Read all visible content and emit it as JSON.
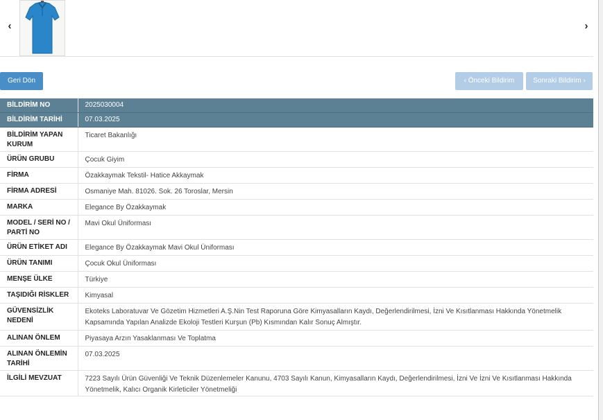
{
  "carousel": {
    "prev_symbol": "‹",
    "next_symbol": "›",
    "image_icon": "shirt-icon",
    "shirt_color": "#2a86c8"
  },
  "buttons": {
    "back": "Geri Dön",
    "prev": "‹ Önceki Bildirim",
    "next": "Sonraki Bildirim ›"
  },
  "colors": {
    "header_row": "#5c8094",
    "primary_button": "#4a8ec8",
    "disabled_button": "#b3cde6"
  },
  "details": [
    {
      "label": "BİLDİRİM NO",
      "value": "2025030004"
    },
    {
      "label": "BİLDİRİM TARİHİ",
      "value": "07.03.2025"
    },
    {
      "label": "BİLDİRİM YAPAN KURUM",
      "value": "Ticaret Bakanlığı"
    },
    {
      "label": "ÜRÜN GRUBU",
      "value": "Çocuk Giyim"
    },
    {
      "label": "FİRMA",
      "value": "Özakkaymak Tekstil- Hatice Akkaymak"
    },
    {
      "label": "FİRMA ADRESİ",
      "value": "Osmaniye Mah. 81026. Sok. 26 Toroslar, Mersin"
    },
    {
      "label": "MARKA",
      "value": "Elegance By Özakkaymak"
    },
    {
      "label": "MODEL / SERİ NO / PARTİ NO",
      "value": "Mavi Okul Üniforması"
    },
    {
      "label": "ÜRÜN ETİKET ADI",
      "value": "Elegance By Özakkaymak Mavi Okul Üniforması"
    },
    {
      "label": "ÜRÜN TANIMI",
      "value": "Çocuk Okul Üniforması"
    },
    {
      "label": "MENŞE ÜLKE",
      "value": "Türkiye"
    },
    {
      "label": "TAŞIDIĞI RİSKLER",
      "value": "Kimyasal"
    },
    {
      "label": "GÜVENSİZLİK NEDENİ",
      "value": "Ekoteks Laboratuvar Ve Gözetim Hizmetleri A.Ş.Nin Test Raporuna Göre Kimyasalların Kaydı, Değerlendirilmesi, İzni Ve Kısıtlanması Hakkında Yönetmelik Kapsamında Yapılan Analizde Ekoloji Testleri Kurşun (Pb) Kısmından Kalır Sonuç Almıştır."
    },
    {
      "label": "ALINAN ÖNLEM",
      "value": "Piyasaya Arzın Yasaklanması Ve Toplatma"
    },
    {
      "label": "ALINAN ÖNLEMİN TARİHİ",
      "value": "07.03.2025"
    },
    {
      "label": "İLGİLİ MEVZUAT",
      "value": "7223 Sayılı Ürün Güvenliği Ve Teknik Düzenlemeler Kanunu, 4703 Sayılı Kanun, Kimyasalların Kaydı, Değerlendirilmesi, İzni Ve İzni Ve Kısıtlanması Hakkında Yönetmelik, Kalıcı Organik Kirleticiler Yönetmeliği"
    }
  ]
}
